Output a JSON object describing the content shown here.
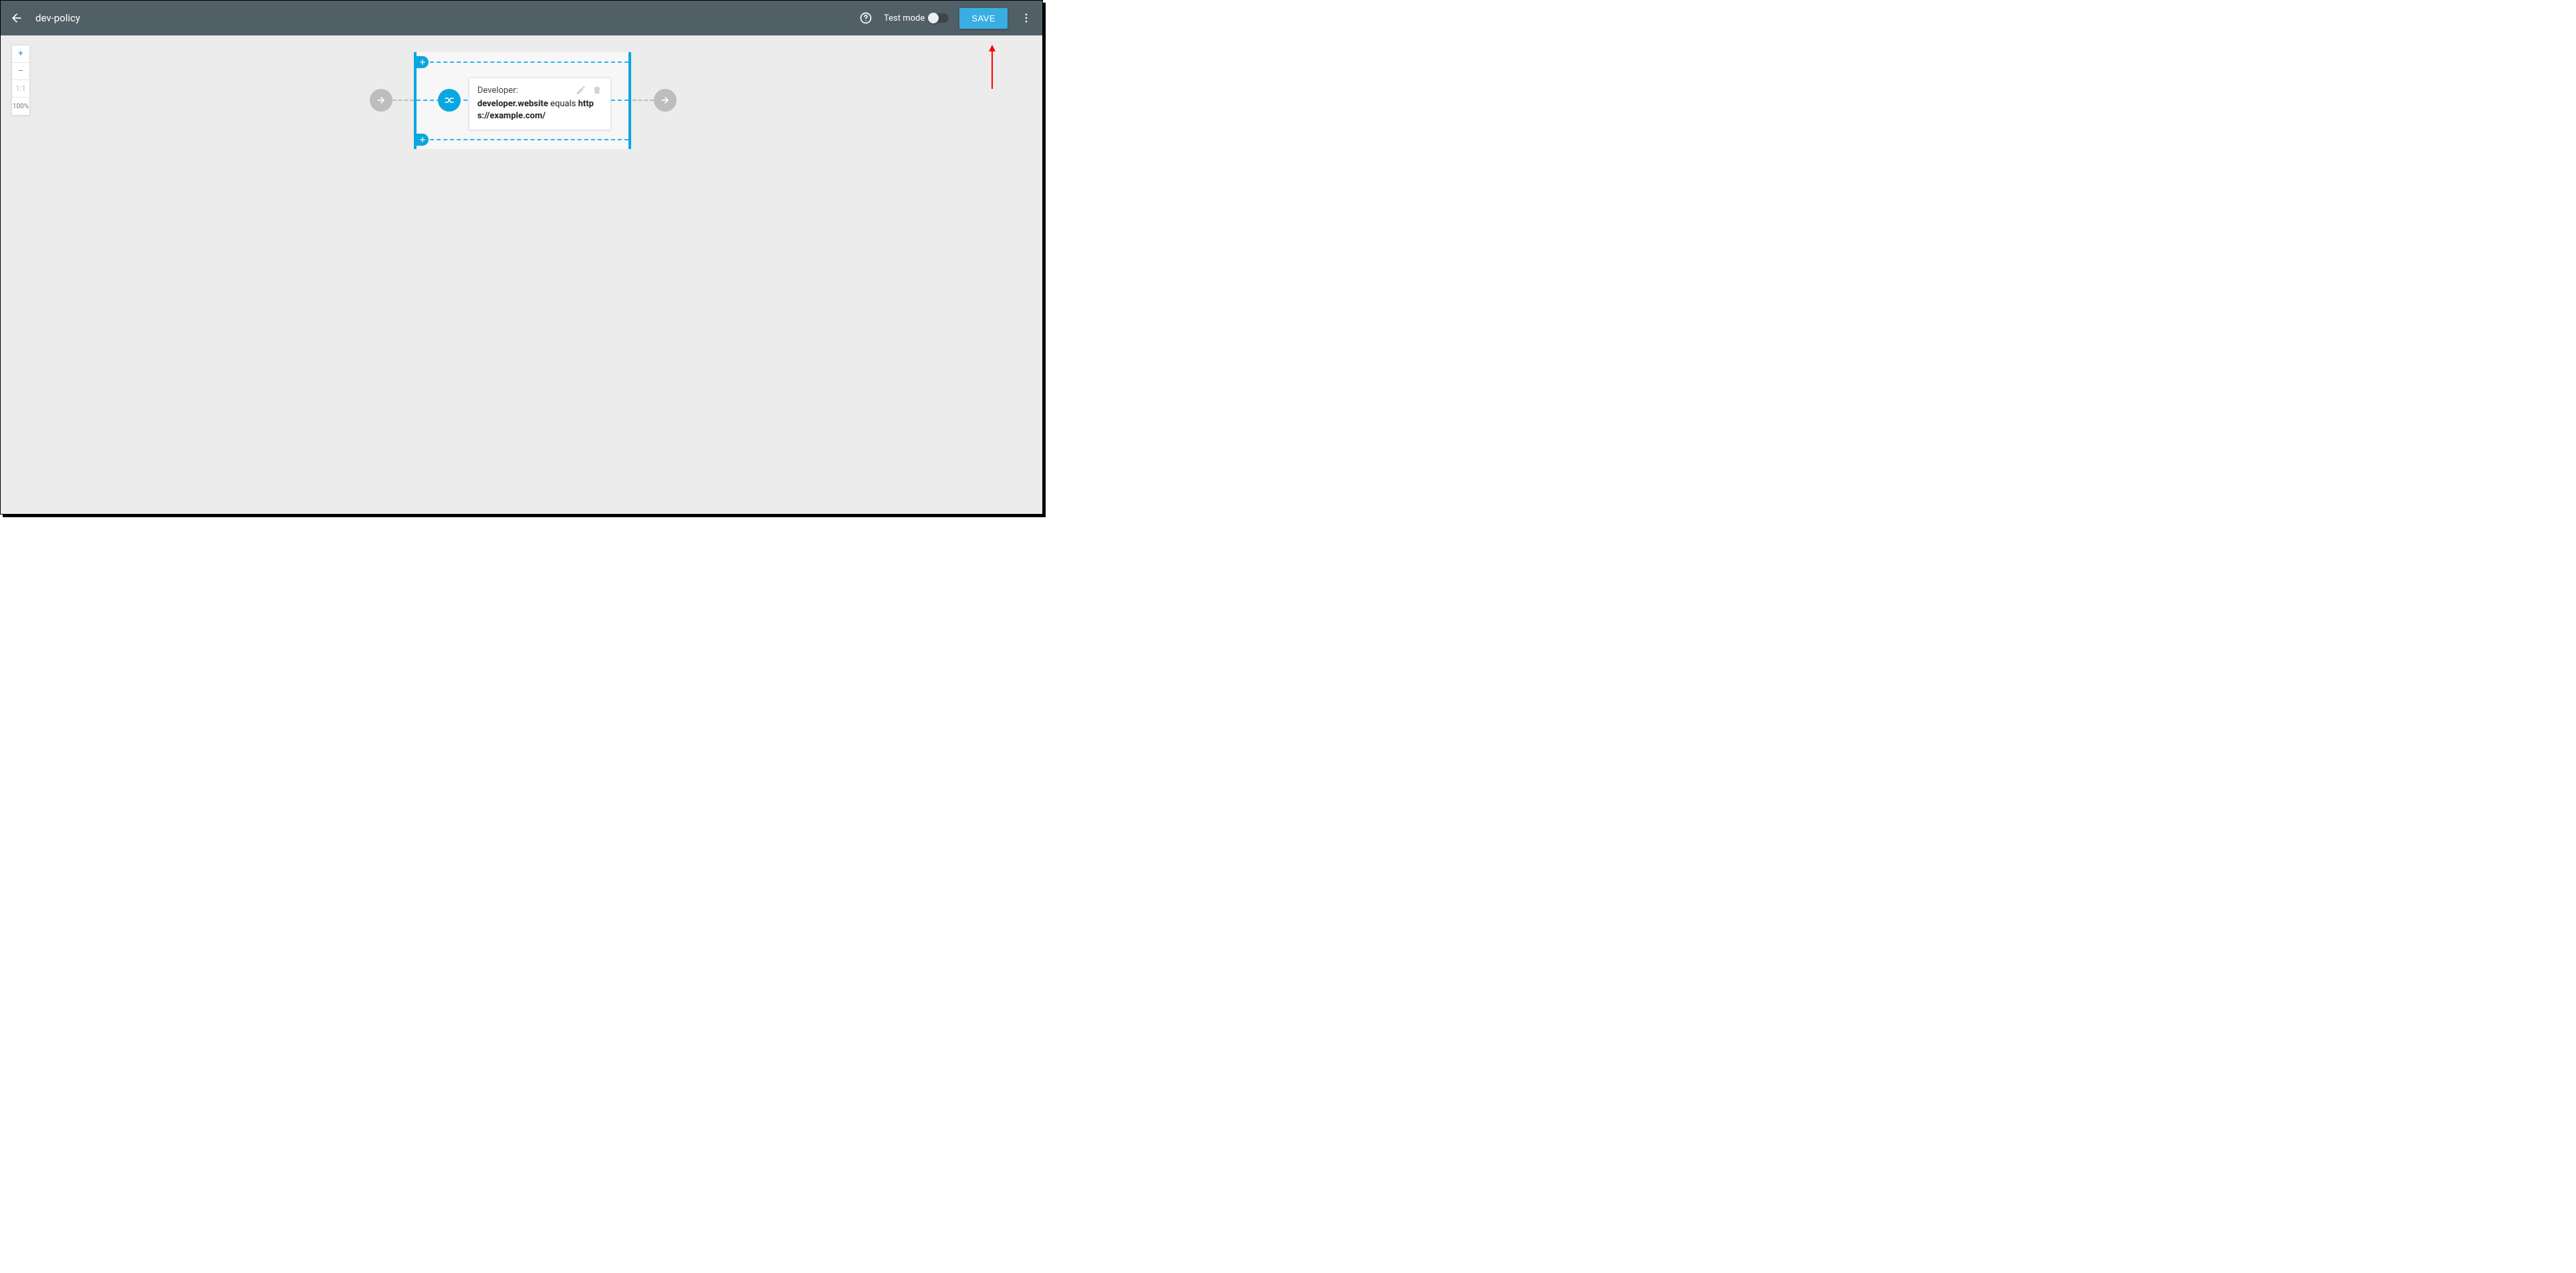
{
  "header": {
    "title": "dev-policy",
    "test_mode_label": "Test mode",
    "save_label": "SAVE"
  },
  "zoom": {
    "plus": "+",
    "minus": "−",
    "ratio": "1:1",
    "percent": "100%"
  },
  "condition": {
    "title": "Developer:",
    "field": "developer.website",
    "operator": "equals",
    "value": "https://example.com/"
  }
}
